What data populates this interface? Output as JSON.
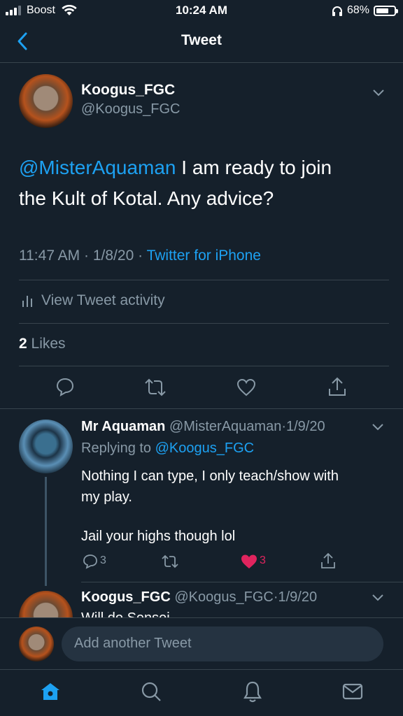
{
  "status_bar": {
    "carrier": "Boost",
    "time": "10:24 AM",
    "battery": "68%"
  },
  "header": {
    "title": "Tweet"
  },
  "tweet": {
    "display_name": "Koogus_FGC",
    "handle": "@Koogus_FGC",
    "mention": "@MisterAquaman",
    "text_rest_1": " I am ready to join",
    "text_line_2": "the Kult of Kotal. Any advice?",
    "time": "11:47 AM",
    "sep1": "·",
    "date": "1/8/20",
    "sep2": "·",
    "source": "Twitter for iPhone",
    "activity_label": "View Tweet activity",
    "likes_count": "2",
    "likes_label": "Likes"
  },
  "reply1": {
    "display_name": "Mr Aquaman",
    "handle": "@MisterAquaman",
    "sep": "·",
    "date": "1/9/20",
    "replying_prefix": "Replying to",
    "replying_handle": "@Koogus_FGC",
    "line1": "Nothing I can type, I only teach/show with",
    "line2": "my play.",
    "line3": "Jail your highs though lol",
    "reply_count": "3",
    "like_count": "3",
    "like_color": "#e0245e"
  },
  "reply2": {
    "display_name": "Koogus_FGC",
    "handle": "@Koogus_FGC",
    "sep": "·",
    "date": "1/9/20",
    "text": "Will do Sensei"
  },
  "composer": {
    "placeholder": "Add another Tweet"
  },
  "tabbar": {
    "icons": [
      "home-icon",
      "search-icon",
      "notifications-icon",
      "messages-icon"
    ]
  },
  "colors": {
    "background": "#15202b",
    "accent": "#1da1f2",
    "muted": "#8899a6",
    "border": "#38444d"
  }
}
